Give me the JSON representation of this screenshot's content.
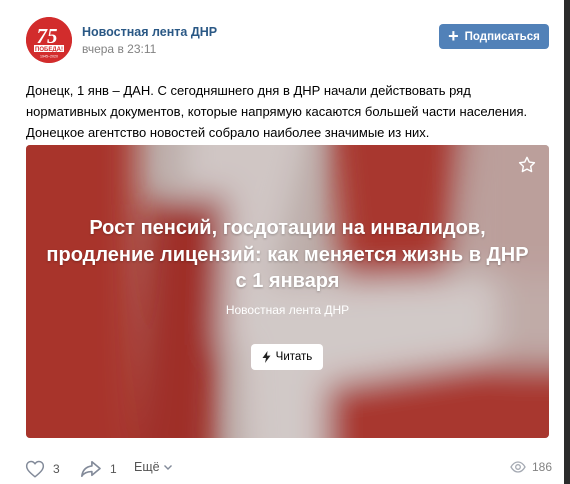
{
  "post": {
    "group_name": "Новостная лента ДНР",
    "time": "вчера в 23:11",
    "subscribe_label": "Подписаться",
    "avatar": {
      "number": "75",
      "caption": "ПОБЕДА!",
      "years": "1945–2020"
    },
    "text": "Донецк, 1 янв – ДАН. С сегодняшнего дня в ДНР начали действовать ряд нормативных документов, которые напрямую касаются большей части населения. Донецкое агентство новостей собрало наиболее значимые из них."
  },
  "preview": {
    "title_lines": [
      "Рост пенсий, госдотации на инвалидов,",
      "продление лицензий: как меняется жизнь в ДНР",
      "с 1 января"
    ],
    "source": "Новостная лента ДНР",
    "read_label": "Читать"
  },
  "footer": {
    "likes": "3",
    "shares": "1",
    "more_label": "Ещё",
    "views": "186"
  },
  "colors": {
    "link": "#2a5885",
    "button": "#5181b8",
    "avatar_red": "#d22c2c",
    "preview_red": "#b0362e"
  },
  "icons": {
    "like": "heart-icon",
    "share": "share-arrow-icon",
    "more": "chevron-down-icon",
    "views": "eye-icon",
    "bookmark": "star-icon",
    "read": "lightning-icon"
  }
}
